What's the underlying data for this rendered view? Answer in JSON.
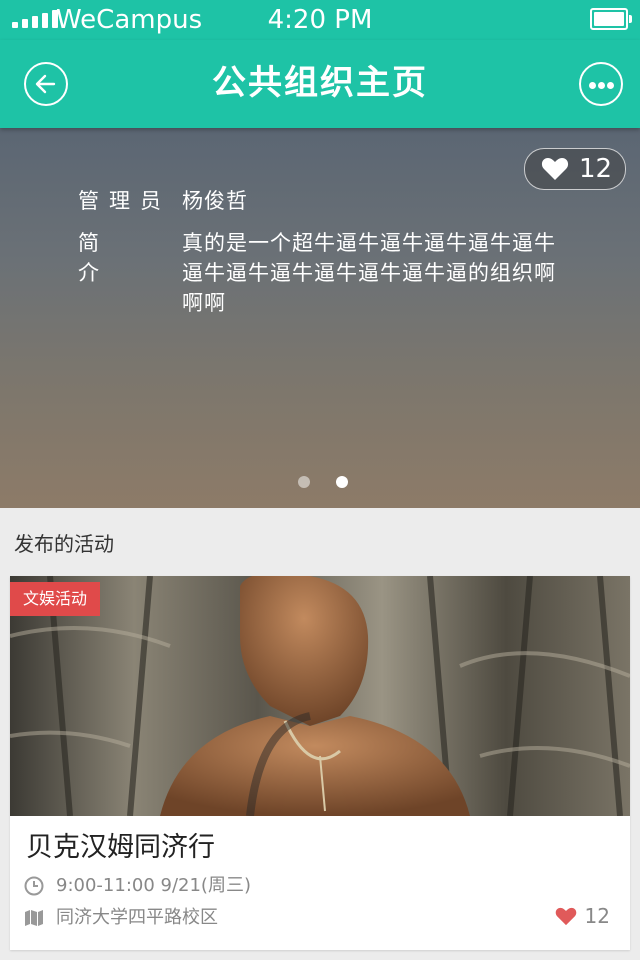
{
  "status_bar": {
    "carrier": "WeCampus",
    "time": "4:20 PM"
  },
  "nav": {
    "title": "公共组织主页",
    "back_icon": "back-arrow-icon",
    "more_icon": "more-dots-icon"
  },
  "banner": {
    "likes": "12",
    "admin_label": "管理员",
    "admin_name": "杨俊哲",
    "intro_label": "简介",
    "intro_text": "真的是一个超牛逼牛逼牛逼牛逼牛逼牛逼牛逼牛逼牛逼牛逼牛逼牛逼的组织啊啊啊",
    "page_count": 2,
    "active_page": 2
  },
  "section": {
    "title": "发布的活动"
  },
  "event": {
    "tag": "文娱活动",
    "title": "贝克汉姆同济行",
    "time": "9:00-11:00 9/21(周三)",
    "location": "同济大学四平路校区",
    "likes": "12"
  },
  "colors": {
    "accent": "#1ec3a6",
    "tag": "#e04a4a",
    "heart": "#e05a5a"
  }
}
